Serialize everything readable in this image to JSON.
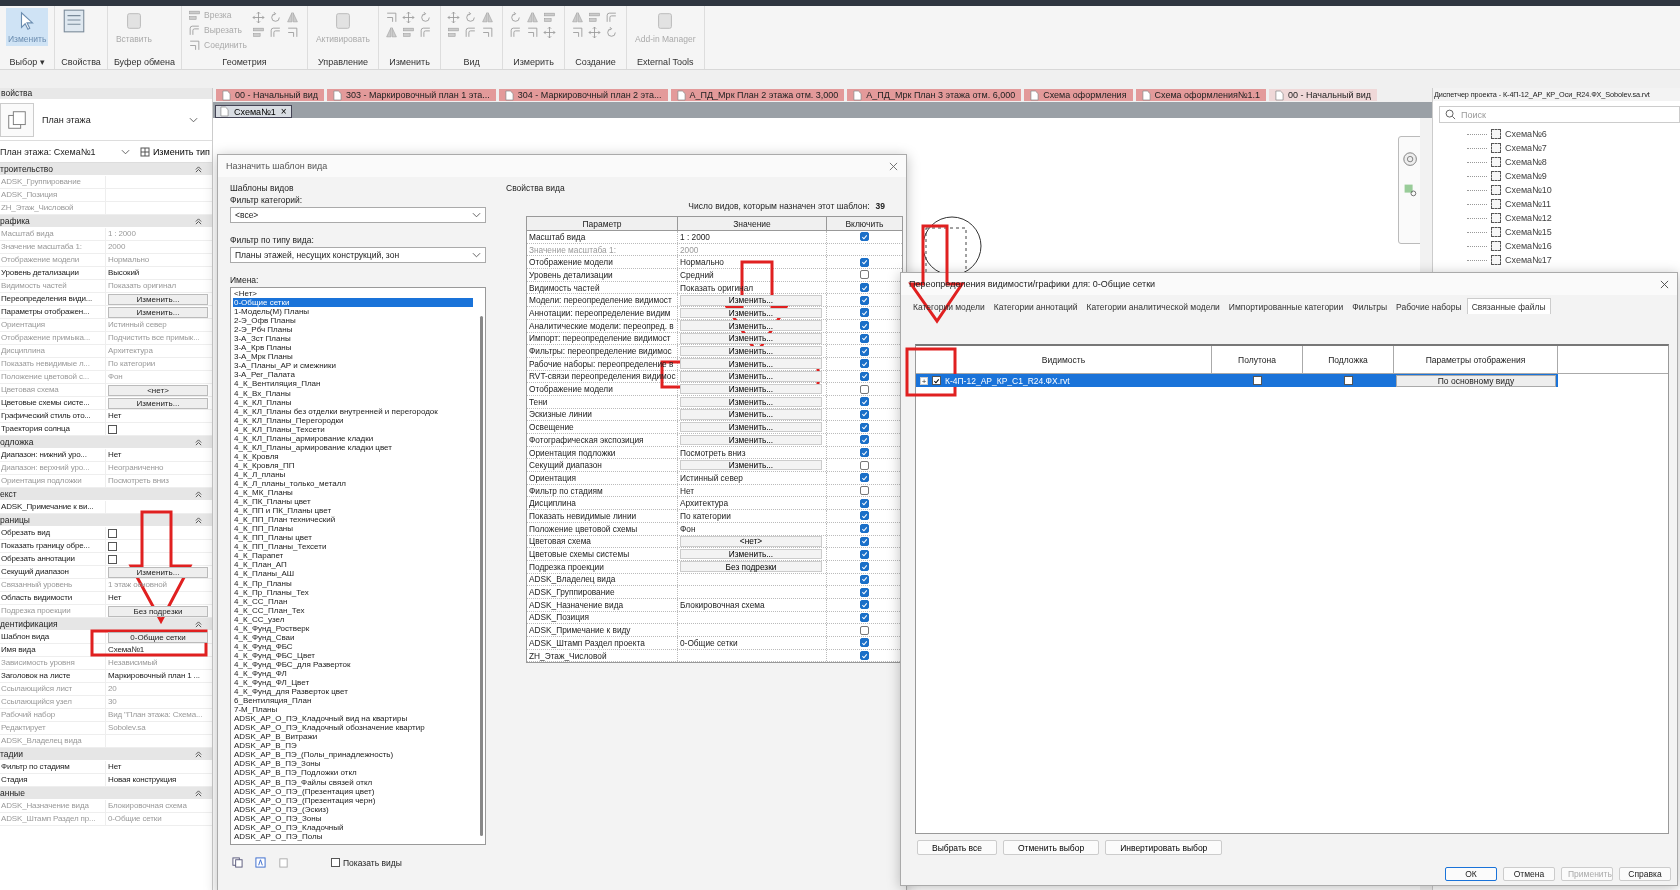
{
  "ribbon": {
    "panels": [
      {
        "label": "Выбор",
        "menu_arrow": "▾",
        "kind": "select",
        "tools": [
          "Изменить"
        ]
      },
      {
        "label": "Свойства",
        "kind": "props"
      },
      {
        "label": "Буфер обмена",
        "kind": "large",
        "tools": [
          "Вставить"
        ]
      },
      {
        "label": "Геометрия",
        "kind": "small",
        "tools": [
          "Врезка",
          "Вырезать",
          "Соединить"
        ]
      },
      {
        "label": "Управление",
        "kind": "large",
        "tools": [
          "Активировать"
        ]
      },
      {
        "label": "Изменить",
        "kind": "icons"
      },
      {
        "label": "Вид",
        "kind": "icons"
      },
      {
        "label": "Измерить",
        "kind": "icons"
      },
      {
        "label": "Создание",
        "kind": "icons"
      },
      {
        "label": "External Tools",
        "kind": "large",
        "tools": [
          "Add-in Manager"
        ]
      }
    ]
  },
  "view_tabs": [
    {
      "label": "00 - Начальный вид",
      "color": "#e39a9a"
    },
    {
      "label": "303 - Маркировочный план 1 эта...",
      "color": "#e39a9a"
    },
    {
      "label": "304 - Маркировочный план 2 эта...",
      "color": "#e39a9a"
    },
    {
      "label": "А_ПД_Мрк План 2 этажа отм. 3,000",
      "color": "#e39a9a"
    },
    {
      "label": "А_ПД_Мрк План 3 этажа отм. 6,000",
      "color": "#e39a9a"
    },
    {
      "label": "Схема оформления",
      "color": "#e39a9a"
    },
    {
      "label": "Схема оформления№1.1",
      "color": "#e39a9a"
    },
    {
      "label": "00 - Начальный вид",
      "color": "#efd8d8"
    }
  ],
  "active_view_tab": {
    "label": "Схема№1",
    "close": "×"
  },
  "properties": {
    "title": "войства",
    "type_name": "План этажа",
    "instance": "План этажа: Схема№1",
    "edit_type": "Изменить тип",
    "groups": [
      {
        "title": "троительство",
        "rows": [
          {
            "name": "ADSK_Группирование",
            "value": "",
            "kind": "text",
            "muted": true
          },
          {
            "name": "ADSK_Позиция",
            "value": "",
            "kind": "text",
            "muted": true
          },
          {
            "name": "ZH_Этаж_Числовой",
            "value": "",
            "kind": "text",
            "muted": true
          }
        ]
      },
      {
        "title": "рафика",
        "rows": [
          {
            "name": "Масштаб вида",
            "value": "1 : 2000",
            "kind": "text",
            "muted": true
          },
          {
            "name": "Значение масштаба    1:",
            "value": "2000",
            "kind": "text",
            "muted": true
          },
          {
            "name": "Отображение модели",
            "value": "Нормально",
            "kind": "text",
            "muted": true
          },
          {
            "name": "Уровень детализации",
            "value": "Высокий",
            "kind": "text",
            "muted": false
          },
          {
            "name": "Видимость частей",
            "value": "Показать оригинал",
            "kind": "text",
            "muted": true
          },
          {
            "name": "Переопределения види...",
            "value": "Изменить...",
            "kind": "button",
            "muted": false
          },
          {
            "name": "Параметры отображен...",
            "value": "Изменить...",
            "kind": "button",
            "muted": false
          },
          {
            "name": "Ориентация",
            "value": "Истинный север",
            "kind": "text",
            "muted": true
          },
          {
            "name": "Отображение примыка...",
            "value": "Подчистить все примык...",
            "kind": "text",
            "muted": true
          },
          {
            "name": "Дисциплина",
            "value": "Архитектура",
            "kind": "text",
            "muted": true
          },
          {
            "name": "Показать невидимые л...",
            "value": "По категории",
            "kind": "text",
            "muted": true
          },
          {
            "name": "Положение цветовой с...",
            "value": "Фон",
            "kind": "text",
            "muted": true
          },
          {
            "name": "Цветовая схема",
            "value": "<нет>",
            "kind": "button",
            "muted": true
          },
          {
            "name": "Цветовые схемы систе...",
            "value": "Изменить...",
            "kind": "button",
            "muted": false
          },
          {
            "name": "Графический стиль ото...",
            "value": "Нет",
            "kind": "text",
            "muted": false
          },
          {
            "name": "Траектория солнца",
            "kind": "checkbox",
            "checked": false,
            "muted": false
          }
        ]
      },
      {
        "title": "одложка",
        "rows": [
          {
            "name": "Диапазон: нижний уро...",
            "value": "Нет",
            "kind": "text",
            "muted": false
          },
          {
            "name": "Диапазон: верхний уро...",
            "value": "Неограниченно",
            "kind": "text",
            "muted": true
          },
          {
            "name": "Ориентация подложки",
            "value": "Посмотреть вниз",
            "kind": "text",
            "muted": true
          }
        ]
      },
      {
        "title": "екст",
        "rows": [
          {
            "name": "ADSK_Примечание к ви...",
            "value": "",
            "kind": "text",
            "muted": false
          }
        ]
      },
      {
        "title": "раницы",
        "rows": [
          {
            "name": "Обрезать вид",
            "kind": "checkbox",
            "checked": false,
            "muted": false
          },
          {
            "name": "Показать границу обре...",
            "kind": "checkbox",
            "checked": false,
            "muted": false
          },
          {
            "name": "Обрезать аннотации",
            "kind": "checkbox",
            "checked": false,
            "muted": false
          },
          {
            "name": "Секущий диапазон",
            "value": "Изменить...",
            "kind": "button",
            "muted": false
          },
          {
            "name": "Связанный уровень",
            "value": "1 этаж основной",
            "kind": "text",
            "muted": true
          },
          {
            "name": "Область видимости",
            "value": "Нет",
            "kind": "text",
            "muted": false
          },
          {
            "name": "Подрезка проекции",
            "value": "Без подрезки",
            "kind": "button",
            "muted": true
          }
        ]
      },
      {
        "title": "дентификация",
        "rows": [
          {
            "name": "Шаблон вида",
            "value": "0-Общие сетки",
            "kind": "button",
            "muted": false
          },
          {
            "name": "Имя вида",
            "value": "Схема№1",
            "kind": "text",
            "muted": false
          },
          {
            "name": "Зависимость уровня",
            "value": "Независимый",
            "kind": "text",
            "muted": true
          },
          {
            "name": "Заголовок на листе",
            "value": "Маркировочный план 1 ...",
            "kind": "text",
            "muted": false
          },
          {
            "name": "Ссылающийся лист",
            "value": "20",
            "kind": "text",
            "muted": true
          },
          {
            "name": "Ссылающийся узел",
            "value": "30",
            "kind": "text",
            "muted": true
          },
          {
            "name": "Рабочий набор",
            "value": "Вид \"План этажа: Схема...",
            "kind": "text",
            "muted": true
          },
          {
            "name": "Редактирует",
            "value": "Sobolev.sa",
            "kind": "text",
            "muted": true
          },
          {
            "name": "ADSK_Владелец вида",
            "value": "",
            "kind": "text",
            "muted": true
          }
        ]
      },
      {
        "title": "тадии",
        "rows": [
          {
            "name": "Фильтр по стадиям",
            "value": "Нет",
            "kind": "text",
            "muted": false
          },
          {
            "name": "Стадия",
            "value": "Новая конструкция",
            "kind": "text",
            "muted": false
          }
        ]
      },
      {
        "title": "анные",
        "rows": [
          {
            "name": "ADSK_Назначение вида",
            "value": "Блокировочная схема",
            "kind": "text",
            "muted": true
          },
          {
            "name": "ADSK_Штамп Раздел пр...",
            "value": "0-Общие сетки",
            "kind": "text",
            "muted": true
          }
        ]
      }
    ]
  },
  "template_dialog": {
    "title": "Назначить шаблон вида",
    "templates_group": "Шаблоны видов",
    "category_label": "Фильтр категорий:",
    "category_value": "<все>",
    "type_label": "Фильтр по типу вида:",
    "type_value": "Планы этажей, несущих конструкций, зон",
    "names_label": "Имена:",
    "names": [
      {
        "label": "<Нет>",
        "selected": false
      },
      {
        "label": "0-Общие сетки",
        "selected": true
      },
      {
        "label": "1-Модель(М) Планы",
        "selected": false
      },
      {
        "label": "2-Э_Офв Планы",
        "selected": false
      },
      {
        "label": "2-Э_Рбч Планы",
        "selected": false
      },
      {
        "label": "3-А_Зст Планы",
        "selected": false
      },
      {
        "label": "3-А_Крв Планы",
        "selected": false
      },
      {
        "label": "3-А_Мрк Планы",
        "selected": false
      },
      {
        "label": "3-А_Планы_АР и смежники",
        "selected": false
      },
      {
        "label": "3-А_Рег_Палата",
        "selected": false
      },
      {
        "label": "4_К_Вентиляция_План",
        "selected": false
      },
      {
        "label": "4_К_Вх_Планы",
        "selected": false
      },
      {
        "label": "4_К_КЛ_Планы",
        "selected": false
      },
      {
        "label": "4_К_КЛ_Планы без отделки внутренней и перегородок",
        "selected": false
      },
      {
        "label": "4_К_КЛ_Планы_Перегородки",
        "selected": false
      },
      {
        "label": "4_К_КЛ_Планы_Техсети",
        "selected": false
      },
      {
        "label": "4_К_КЛ_Планы_армирование кладки",
        "selected": false
      },
      {
        "label": "4_К_КЛ_Планы_армирование кладки цвет",
        "selected": false
      },
      {
        "label": "4_К_Кровля",
        "selected": false
      },
      {
        "label": "4_К_Кровля_ПП",
        "selected": false
      },
      {
        "label": "4_К_Л_планы",
        "selected": false
      },
      {
        "label": "4_К_Л_планы_только_металл",
        "selected": false
      },
      {
        "label": "4_К_МК_Планы",
        "selected": false
      },
      {
        "label": "4_К_ПК_Планы цвет",
        "selected": false
      },
      {
        "label": "4_К_ПП и ПК_Планы цвет",
        "selected": false
      },
      {
        "label": "4_К_ПП_План технический",
        "selected": false
      },
      {
        "label": "4_К_ПП_Планы",
        "selected": false
      },
      {
        "label": "4_К_ПП_Планы цвет",
        "selected": false
      },
      {
        "label": "4_К_ПП_Планы_Техсети",
        "selected": false
      },
      {
        "label": "4_К_Парапет",
        "selected": false
      },
      {
        "label": "4_К_План_АП",
        "selected": false
      },
      {
        "label": "4_К_Планы_АШ",
        "selected": false
      },
      {
        "label": "4_К_Пр_Планы",
        "selected": false
      },
      {
        "label": "4_К_Пр_Планы_Тех",
        "selected": false
      },
      {
        "label": "4_К_СС_План",
        "selected": false
      },
      {
        "label": "4_К_СС_План_Тех",
        "selected": false
      },
      {
        "label": "4_К_СС_узел",
        "selected": false
      },
      {
        "label": "4_К_Фунд_Ростверк",
        "selected": false
      },
      {
        "label": "4_К_Фунд_Сваи",
        "selected": false
      },
      {
        "label": "4_К_Фунд_ФБС",
        "selected": false
      },
      {
        "label": "4_К_Фунд_ФБС_Цвет",
        "selected": false
      },
      {
        "label": "4_К_Фунд_ФБС_для Разверток",
        "selected": false
      },
      {
        "label": "4_К_Фунд_ФЛ",
        "selected": false
      },
      {
        "label": "4_К_Фунд_ФЛ_Цвет",
        "selected": false
      },
      {
        "label": "4_К_Фунд_для Разверток цвет",
        "selected": false
      },
      {
        "label": "6_Вентиляция_План",
        "selected": false
      },
      {
        "label": "7-М_Планы",
        "selected": false
      },
      {
        "label": "ADSK_АР_О_ПЭ_Кладочный вид на квартиры",
        "selected": false
      },
      {
        "label": "ADSK_АР_О_ПЭ_Кладочный обозначение квартир",
        "selected": false
      },
      {
        "label": "ADSK_АР_В_Витражи",
        "selected": false
      },
      {
        "label": "ADSK_АР_В_ПЭ",
        "selected": false
      },
      {
        "label": "ADSK_АР_В_ПЭ_(Полы_принадлежность)",
        "selected": false
      },
      {
        "label": "ADSK_АР_В_ПЭ_Зоны",
        "selected": false
      },
      {
        "label": "ADSK_АР_В_ПЭ_Подложки откл",
        "selected": false
      },
      {
        "label": "ADSK_АР_В_ПЭ_Файлы связей откл",
        "selected": false
      },
      {
        "label": "ADSK_АР_О_ПЭ_(Презентация цвет)",
        "selected": false
      },
      {
        "label": "ADSK_АР_О_ПЭ_(Презентация черн)",
        "selected": false
      },
      {
        "label": "ADSK_АР_О_ПЭ_(Эскиз)",
        "selected": false
      },
      {
        "label": "ADSK_АР_О_ПЭ_Зоны",
        "selected": false
      },
      {
        "label": "ADSK_АР_О_ПЭ_Кладочный",
        "selected": false
      },
      {
        "label": "ADSK_АР_О_ПЭ_Полы",
        "selected": false
      }
    ],
    "show_views": {
      "label": "Показать виды",
      "checked": false
    },
    "props_group": "Свойства вида",
    "count_label": "Число видов, которым назначен этот шаблон:",
    "count": "39",
    "columns": [
      "Параметр",
      "Значение",
      "Включить"
    ],
    "rows": [
      {
        "param": "Масштаб вида",
        "value": "1 : 2000",
        "kind": "text",
        "muted": false,
        "include": true
      },
      {
        "param": "Значение масштаба    1:",
        "value": "2000",
        "kind": "text",
        "muted": true
      },
      {
        "param": "Отображение модели",
        "value": "Нормально",
        "kind": "text",
        "muted": false,
        "include": true
      },
      {
        "param": "Уровень детализации",
        "value": "Средний",
        "kind": "text",
        "muted": false,
        "include": false
      },
      {
        "param": "Видимость частей",
        "value": "Показать оригинал",
        "kind": "text",
        "muted": false,
        "include": true
      },
      {
        "param": "Модели: переопределение видимост",
        "value": "Изменить...",
        "kind": "button",
        "muted": false,
        "include": true
      },
      {
        "param": "Аннотации: переопределение видим",
        "value": "Изменить...",
        "kind": "button",
        "muted": false,
        "include": true
      },
      {
        "param": "Аналитические модели: переопред. в",
        "value": "Изменить...",
        "kind": "button",
        "muted": false,
        "include": true
      },
      {
        "param": "Импорт: переопределение видимост",
        "value": "Изменить...",
        "kind": "button",
        "muted": false,
        "include": true
      },
      {
        "param": "Фильтры: переопределение видимос",
        "value": "Изменить...",
        "kind": "button",
        "muted": false,
        "include": true
      },
      {
        "param": "Рабочие наборы: переопределение в",
        "value": "Изменить...",
        "kind": "button",
        "muted": false,
        "include": true
      },
      {
        "param": "RVT-связи переопределения видимос",
        "value": "Изменить...",
        "kind": "button",
        "muted": false,
        "include": true
      },
      {
        "param": "Отображение модели",
        "value": "Изменить...",
        "kind": "button",
        "muted": false,
        "include": false
      },
      {
        "param": "Тени",
        "value": "Изменить...",
        "kind": "button",
        "muted": false,
        "include": true
      },
      {
        "param": "Эскизные линии",
        "value": "Изменить...",
        "kind": "button",
        "muted": false,
        "include": true
      },
      {
        "param": "Освещение",
        "value": "Изменить...",
        "kind": "button",
        "muted": false,
        "include": true
      },
      {
        "param": "Фотографическая экспозиция",
        "value": "Изменить...",
        "kind": "button",
        "muted": false,
        "include": true
      },
      {
        "param": "Ориентация подложки",
        "value": "Посмотреть вниз",
        "kind": "text",
        "muted": false,
        "include": true
      },
      {
        "param": "Секущий диапазон",
        "value": "Изменить...",
        "kind": "button",
        "muted": false,
        "include": false
      },
      {
        "param": "Ориентация",
        "value": "Истинный север",
        "kind": "text",
        "muted": false,
        "include": true
      },
      {
        "param": "Фильтр по стадиям",
        "value": "Нет",
        "kind": "text",
        "muted": false,
        "include": false
      },
      {
        "param": "Дисциплина",
        "value": "Архитектура",
        "kind": "text",
        "muted": false,
        "include": true
      },
      {
        "param": "Показать невидимые линии",
        "value": "По категории",
        "kind": "text",
        "muted": false,
        "include": true
      },
      {
        "param": "Положение цветовой схемы",
        "value": "Фон",
        "kind": "text",
        "muted": false,
        "include": true
      },
      {
        "param": "Цветовая схема",
        "value": "<нет>",
        "kind": "button",
        "muted": false,
        "include": true
      },
      {
        "param": "Цветовые схемы системы",
        "value": "Изменить...",
        "kind": "button",
        "muted": false,
        "include": true
      },
      {
        "param": "Подрезка проекции",
        "value": "Без подрезки",
        "kind": "button",
        "muted": false,
        "include": true
      },
      {
        "param": "ADSK_Владелец вида",
        "value": "",
        "kind": "text",
        "muted": false,
        "include": true
      },
      {
        "param": "ADSK_Группирование",
        "value": "",
        "kind": "text",
        "muted": false,
        "include": true
      },
      {
        "param": "ADSK_Назначение вида",
        "value": "Блокировочная схема",
        "kind": "text",
        "muted": false,
        "include": true
      },
      {
        "param": "ADSK_Позиция",
        "value": "",
        "kind": "text",
        "muted": false,
        "include": true
      },
      {
        "param": "ADSK_Примечание к виду",
        "value": "",
        "kind": "text",
        "muted": false,
        "include": false
      },
      {
        "param": "ADSK_Штамп Раздел проекта",
        "value": "0-Общие сетки",
        "kind": "text",
        "muted": false,
        "include": true
      },
      {
        "param": "ZH_Этаж_Числовой",
        "value": "",
        "kind": "text",
        "muted": false,
        "include": true
      }
    ]
  },
  "vg_dialog": {
    "title": "Переопределения видимости/графики для: 0-Общие сетки",
    "tabs": [
      {
        "label": "Категории модели",
        "selected": false
      },
      {
        "label": "Категории аннотаций",
        "selected": false
      },
      {
        "label": "Категории аналитической модели",
        "selected": false
      },
      {
        "label": "Импортированные категории",
        "selected": false
      },
      {
        "label": "Фильтры",
        "selected": false
      },
      {
        "label": "Рабочие наборы",
        "selected": false
      },
      {
        "label": "Связанные файлы",
        "selected": true
      }
    ],
    "columns": [
      "Видимость",
      "Полутона",
      "Подложка",
      "Параметры отображения"
    ],
    "rows": [
      {
        "expand": "+",
        "visible": true,
        "name": "К-4П-12_АР_КР_С1_R24.ФХ.rvt",
        "halftone": false,
        "underlay": false,
        "display": "По основному виду",
        "selected": true
      }
    ],
    "actions": [
      "Выбрать все",
      "Отменить выбор",
      "Инвертировать выбор"
    ],
    "buttons": [
      {
        "label": "ОК",
        "kind": "default"
      },
      {
        "label": "Отмена",
        "kind": "normal"
      },
      {
        "label": "Применить",
        "kind": "disabled"
      },
      {
        "label": "Справка",
        "kind": "normal"
      }
    ]
  },
  "project_browser": {
    "title": "Диспетчер проекта - К-4П-12_АР_КР_Оси_R24.ФХ_Sobolev.sa.rvt",
    "search_placeholder": "Поиск",
    "items": [
      "Схема№6",
      "Схема№7",
      "Схема№8",
      "Схема№9",
      "Схема№10",
      "Схема№11",
      "Схема№12",
      "Схема№15",
      "Схема№16",
      "Схема№17"
    ]
  }
}
